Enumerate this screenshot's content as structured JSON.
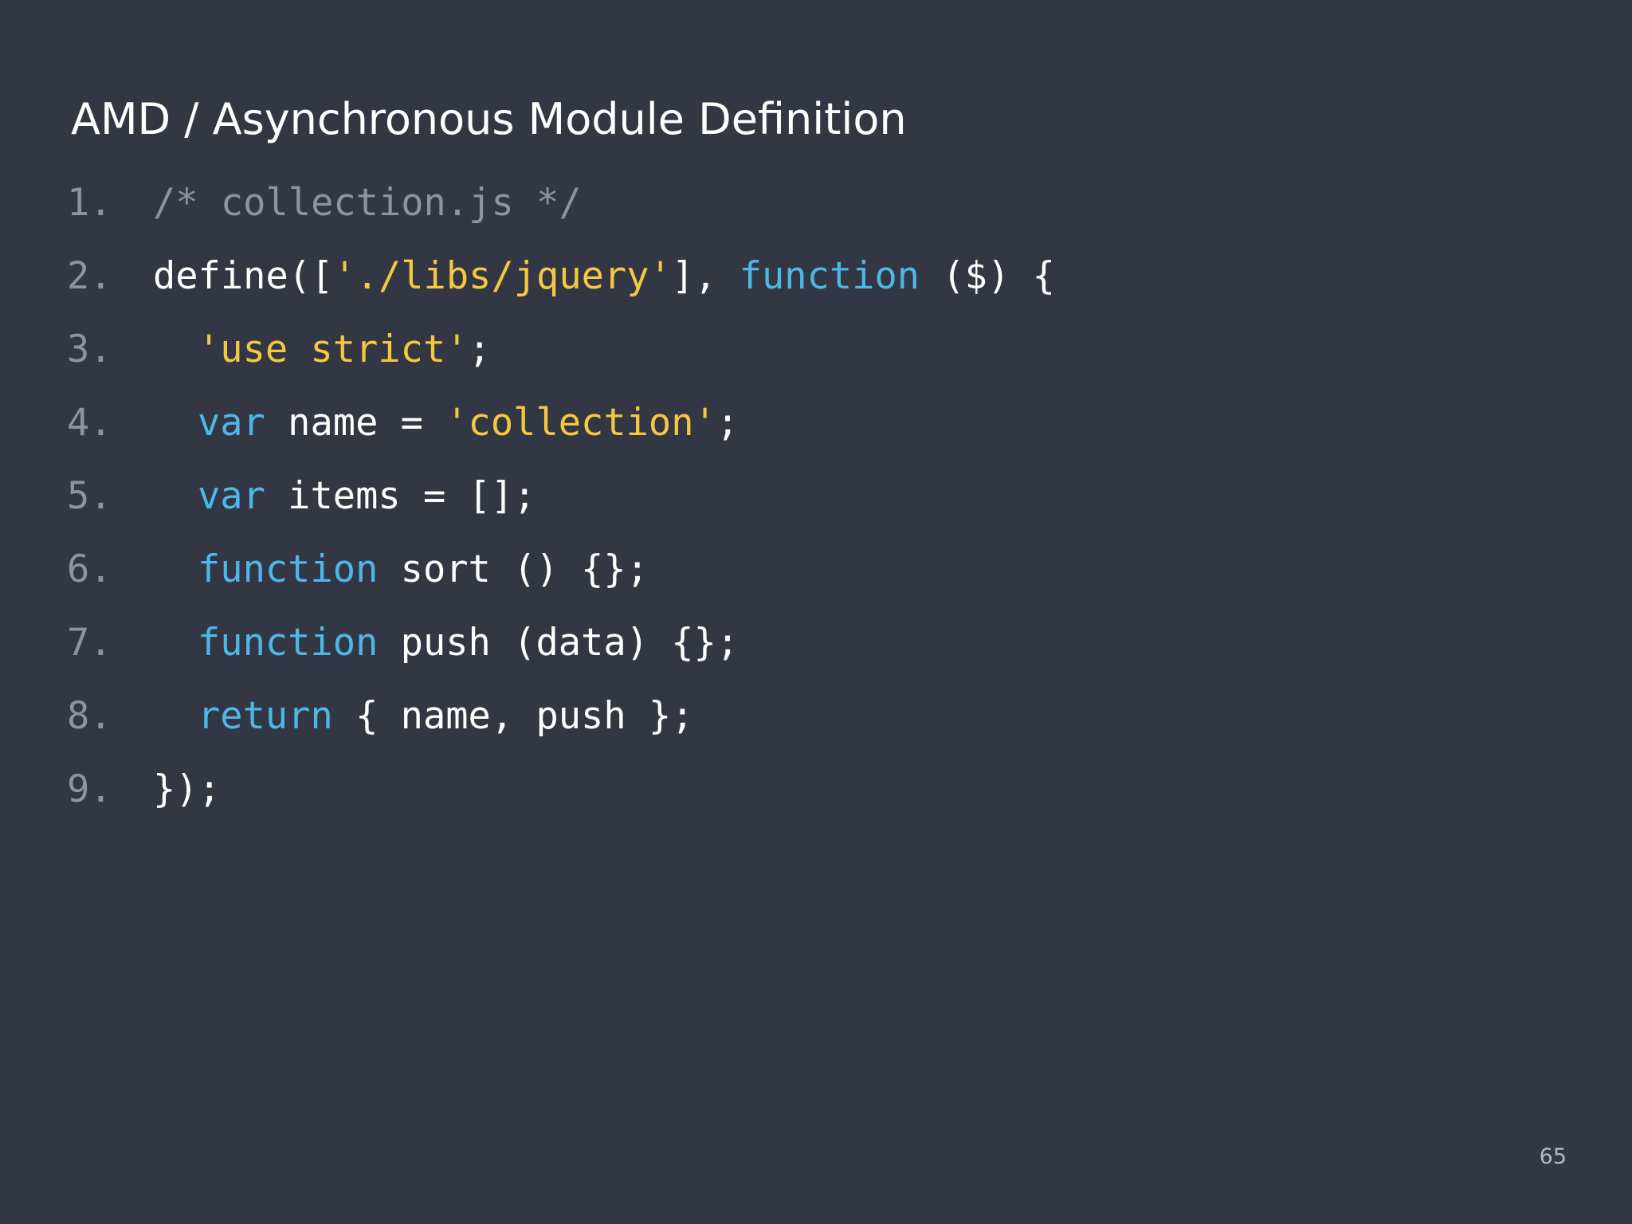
{
  "slide": {
    "title": "AMD / Asynchronous Module Definition",
    "page_number": "65"
  },
  "colors": {
    "background": "#333743",
    "text": "#ffffff",
    "comment": "#8e949b",
    "string": "#f5c842",
    "keyword": "#4db7e8"
  },
  "code": {
    "lines": [
      {
        "number": "1.",
        "indent": 0,
        "tokens": [
          {
            "type": "comment",
            "text": "/* collection.js */"
          }
        ]
      },
      {
        "number": "2.",
        "indent": 0,
        "tokens": [
          {
            "type": "plain",
            "text": "define(["
          },
          {
            "type": "string",
            "text": "'./libs/jquery'"
          },
          {
            "type": "plain",
            "text": "], "
          },
          {
            "type": "keyword",
            "text": "function"
          },
          {
            "type": "plain",
            "text": " ($) {"
          }
        ]
      },
      {
        "number": "3.",
        "indent": 1,
        "tokens": [
          {
            "type": "string",
            "text": "'use strict'"
          },
          {
            "type": "plain",
            "text": ";"
          }
        ]
      },
      {
        "number": "4.",
        "indent": 1,
        "tokens": [
          {
            "type": "keyword",
            "text": "var"
          },
          {
            "type": "plain",
            "text": " name = "
          },
          {
            "type": "string",
            "text": "'collection'"
          },
          {
            "type": "plain",
            "text": ";"
          }
        ]
      },
      {
        "number": "5.",
        "indent": 1,
        "tokens": [
          {
            "type": "keyword",
            "text": "var"
          },
          {
            "type": "plain",
            "text": " items = [];"
          }
        ]
      },
      {
        "number": "6.",
        "indent": 1,
        "tokens": [
          {
            "type": "keyword",
            "text": "function"
          },
          {
            "type": "plain",
            "text": " sort () {};"
          }
        ]
      },
      {
        "number": "7.",
        "indent": 1,
        "tokens": [
          {
            "type": "keyword",
            "text": "function"
          },
          {
            "type": "plain",
            "text": " push (data) {};"
          }
        ]
      },
      {
        "number": "8.",
        "indent": 1,
        "tokens": [
          {
            "type": "keyword",
            "text": "return"
          },
          {
            "type": "plain",
            "text": " { name, push };"
          }
        ]
      },
      {
        "number": "9.",
        "indent": 0,
        "tokens": [
          {
            "type": "plain",
            "text": "});"
          }
        ]
      }
    ]
  }
}
